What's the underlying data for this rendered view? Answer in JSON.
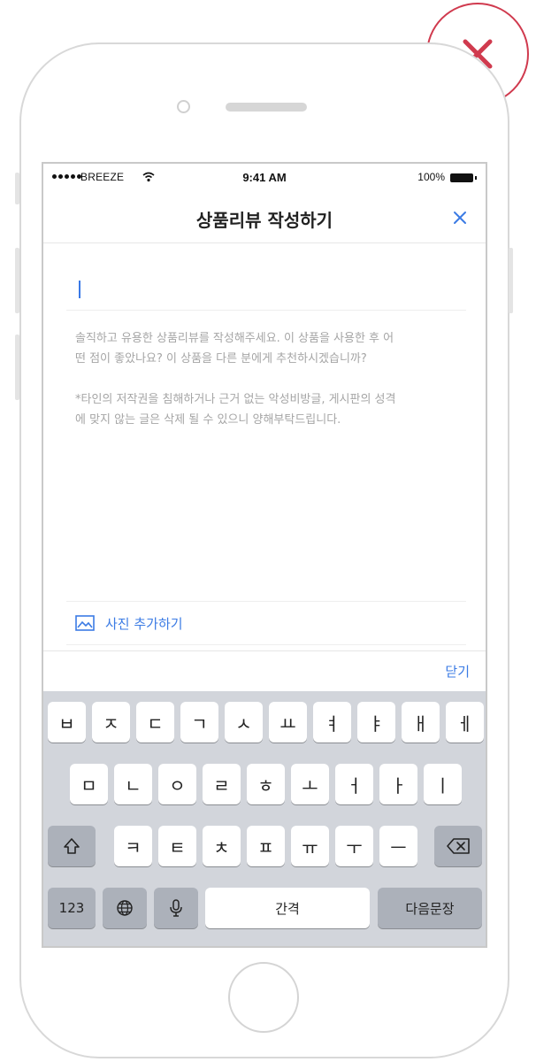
{
  "badge": {
    "icon": "close-x-icon",
    "color": "#d03a4e"
  },
  "status_bar": {
    "carrier": "BREEZE",
    "time": "9:41 AM",
    "battery": "100%"
  },
  "nav": {
    "title": "상품리뷰 작성하기",
    "close_icon": "close-icon"
  },
  "title_input": {
    "value": ""
  },
  "review": {
    "placeholder_1": "솔직하고 유용한 상품리뷰를 작성해주세요. 이 상품을 사용한 후 어떤 점이 좋았나요? 이 상품을 다른 분에게 추천하시겠습니까?",
    "placeholder_2": "*타인의 저작권을 침해하거나 근거 없는 악성비방글, 게시판의 성격에 맞지 않는 글은 삭제 될 수 있으니 양해부탁드립니다."
  },
  "photo": {
    "label": "사진 추가하기",
    "icon": "image-icon"
  },
  "accessory": {
    "done_label": "닫기"
  },
  "keyboard": {
    "row1": [
      "ㅂ",
      "ㅈ",
      "ㄷ",
      "ㄱ",
      "ㅅ",
      "ㅛ",
      "ㅕ",
      "ㅑ",
      "ㅐ",
      "ㅔ"
    ],
    "row2": [
      "ㅁ",
      "ㄴ",
      "ㅇ",
      "ㄹ",
      "ㅎ",
      "ㅗ",
      "ㅓ",
      "ㅏ",
      "ㅣ"
    ],
    "row3": [
      "ㅋ",
      "ㅌ",
      "ㅊ",
      "ㅍ",
      "ㅠ",
      "ㅜ",
      "ㅡ"
    ],
    "numbers_label": "123",
    "space_label": "간격",
    "return_label": "다음문장"
  },
  "colors": {
    "accent": "#3b7be4",
    "badge_red": "#d03a4e",
    "keyboard_bg": "#d2d5db"
  }
}
